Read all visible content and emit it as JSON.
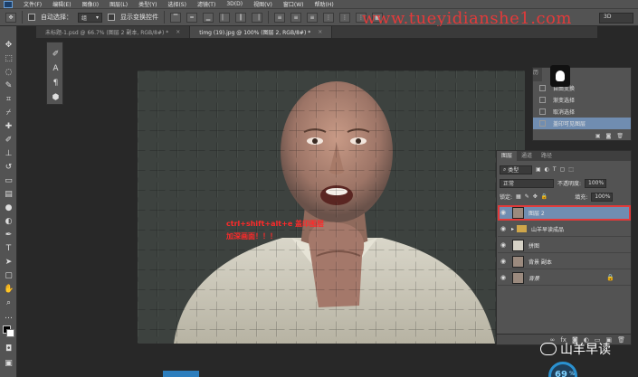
{
  "menubar": {
    "items": [
      "文件(F)",
      "编辑(E)",
      "图像(I)",
      "图层(L)",
      "类型(Y)",
      "选择(S)",
      "滤镜(T)",
      "3D(D)",
      "视图(V)",
      "窗口(W)",
      "帮助(H)"
    ]
  },
  "options": {
    "auto_select_label": "自动选择：",
    "auto_select_value": "组",
    "show_transform_label": "显示变换控件",
    "workspace": "3D"
  },
  "watermark_url": "www.tueyidianshe1.com",
  "tabs": [
    {
      "label": "未标题-1.psd @ 66.7% (图层 2 副本, RGB/8#) *",
      "active": false
    },
    {
      "label": "timg (19).jpg @ 100% (图层 2, RGB/8#) *",
      "active": true
    }
  ],
  "canvas": {
    "annotation_line1": "ctrl+shift+alt+e 盖印图层",
    "annotation_line2": "加深画面！！！"
  },
  "history": {
    "tag": "历",
    "items": [
      {
        "label": "自由变换",
        "selected": false
      },
      {
        "label": "渐变选择",
        "selected": false
      },
      {
        "label": "取消选择",
        "selected": false
      },
      {
        "label": "盖印可见图层",
        "selected": true
      }
    ]
  },
  "layers": {
    "tabs": [
      "图层",
      "通道",
      "路径"
    ],
    "kind_label": "类型",
    "blend_mode": "正常",
    "opacity_label": "不透明度:",
    "opacity_value": "100%",
    "lock_label": "锁定:",
    "fill_label": "填充:",
    "fill_value": "100%",
    "items": [
      {
        "name": "图层 2",
        "type": "image",
        "selected": true
      },
      {
        "name": "山羊早读成品",
        "type": "folder",
        "selected": false
      },
      {
        "name": "拼图",
        "type": "image",
        "selected": false
      },
      {
        "name": "背景 副本",
        "type": "image",
        "selected": false
      },
      {
        "name": "背景",
        "type": "image",
        "selected": false,
        "locked": true
      }
    ]
  },
  "brand": {
    "text": "山羊早读"
  },
  "gauge": {
    "value": "69",
    "unit": "%"
  },
  "colors": {
    "accent": "#708db1",
    "annotation": "#ff2a2a",
    "highlight_box": "#e23a3a"
  }
}
